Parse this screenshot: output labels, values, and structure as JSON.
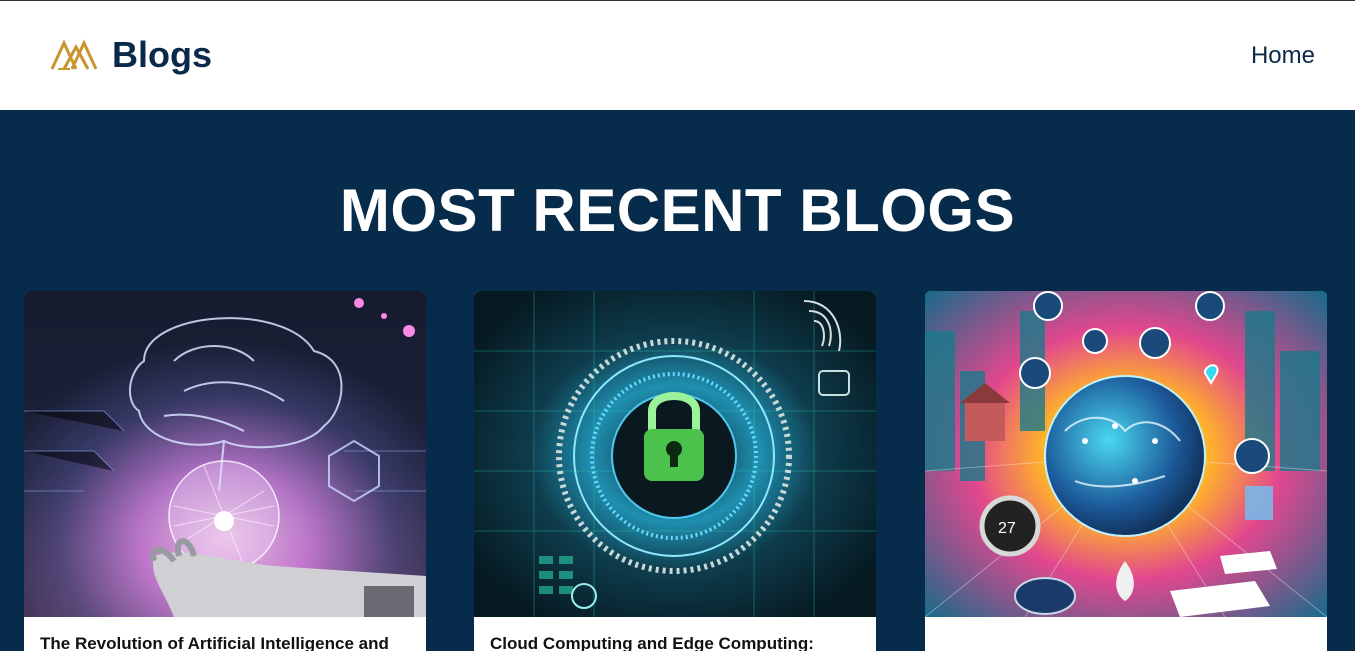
{
  "brand": {
    "name": "Blogs",
    "logo_icon": "mountain-logo-icon"
  },
  "nav": {
    "home_label": "Home"
  },
  "hero": {
    "title": "MOST RECENT BLOGS"
  },
  "cards": [
    {
      "title": "The Revolution of Artificial Intelligence and",
      "image": "ai-brain-robot-hand-illustration"
    },
    {
      "title": "Cloud Computing and Edge Computing:",
      "image": "cybersecurity-padlock-illustration"
    },
    {
      "title": "",
      "image": "iot-globe-smart-devices-illustration"
    }
  ],
  "colors": {
    "navbar_bg": "#ffffff",
    "hero_bg": "#062b4b",
    "brand_text": "#0b2a4a",
    "logo_gold": "#c9962e",
    "title_text": "#ffffff"
  }
}
